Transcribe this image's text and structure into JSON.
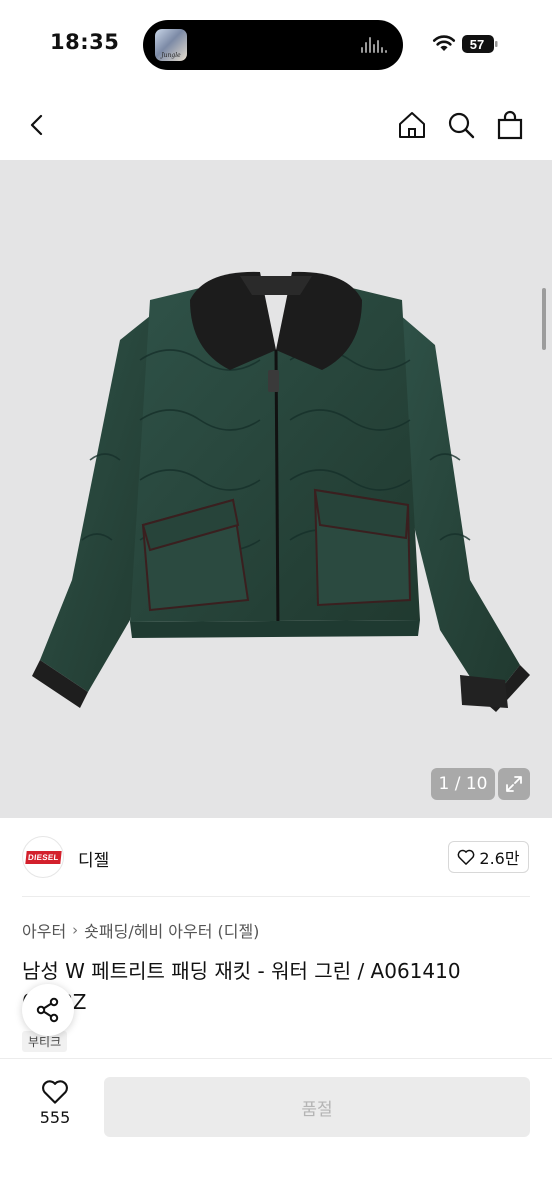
{
  "status_bar": {
    "time": "18:35",
    "battery": "57",
    "album_art_text": "Jungle"
  },
  "nav": {
    "icons": [
      "back-icon",
      "home-icon",
      "search-icon",
      "bag-icon"
    ]
  },
  "gallery": {
    "counter": "1 / 10",
    "expand_icon": "expand-icon"
  },
  "brand": {
    "logo_text": "DIESEL",
    "name": "디젤",
    "likes": "2.6만",
    "accent": "#d3202c"
  },
  "category": {
    "parent": "아우터",
    "child": "숏패딩/헤비 아우터 (디젤)"
  },
  "product": {
    "title": "남성 W 페트리트 패딩 재킷 - 워터 그린 / A061410 0E58Z",
    "tag": "부티크"
  },
  "actions": {
    "wish_count": "555",
    "buy_label": "품절"
  }
}
